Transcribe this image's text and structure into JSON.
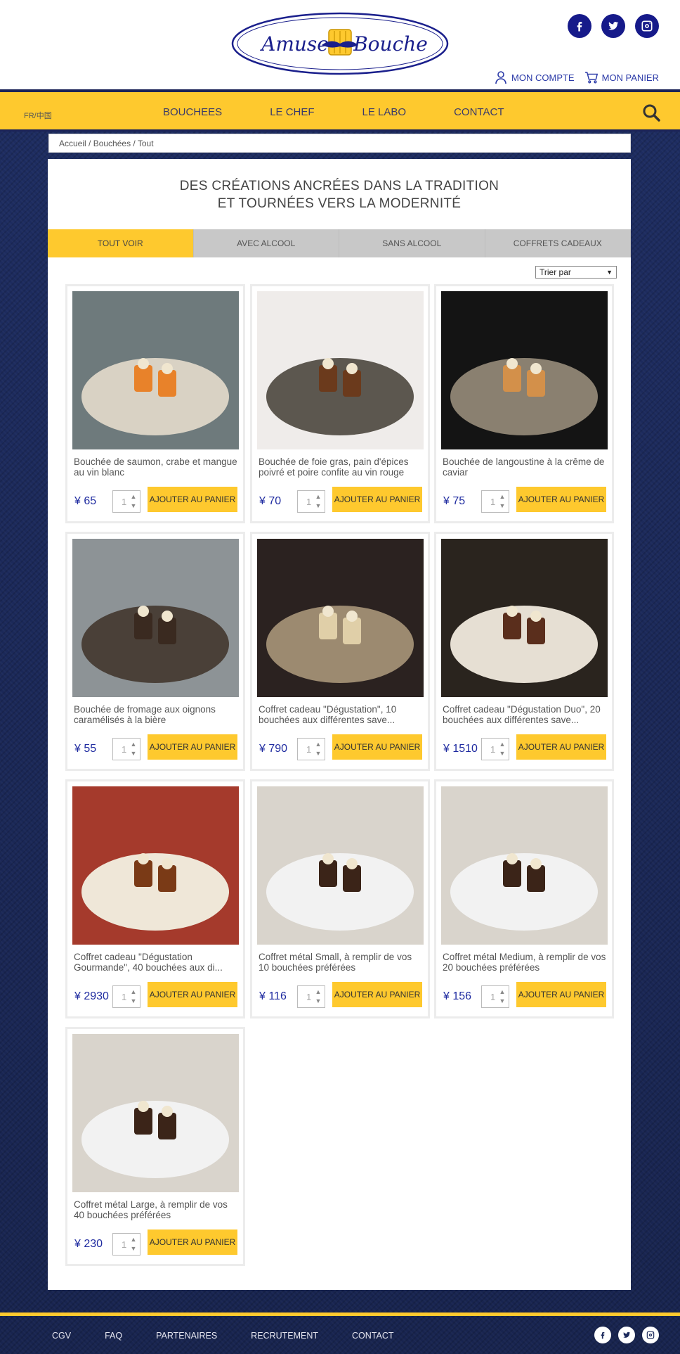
{
  "header": {
    "logo_text_left": "Amuse",
    "logo_text_right": "Bouche",
    "account_label": "MON COMPTE",
    "cart_label": "MON PANIER",
    "social": [
      "facebook-icon",
      "twitter-icon",
      "instagram-icon"
    ]
  },
  "nav": {
    "lang": "FR/中国",
    "items": [
      "BOUCHEES",
      "LE CHEF",
      "LE LABO",
      "CONTACT"
    ]
  },
  "breadcrumb": {
    "home": "Accueil",
    "sep1": " / ",
    "category": "Bouchées",
    "sep2": " / ",
    "current": "Tout"
  },
  "headline": {
    "line1": "DES CRÉATIONS ANCRÉES DANS LA TRADITION",
    "line2": "ET TOURNÉES VERS LA MODERNITÉ"
  },
  "tabs": [
    "TOUT VOIR",
    "AVEC ALCOOL",
    "SANS ALCOOL",
    "COFFRETS CADEAUX"
  ],
  "sort_label": "Trier par",
  "add_label": "AJOUTER AU PANIER",
  "qty_default": "1",
  "products": [
    {
      "name": "Bouchée de saumon, crabe et mangue au vin blanc",
      "price": "¥ 65"
    },
    {
      "name": "Bouchée de foie gras, pain d'épices poivré et poire confite au vin rouge",
      "price": "¥ 70"
    },
    {
      "name": "Bouchée de langoustine à la crême de caviar",
      "price": "¥ 75"
    },
    {
      "name": "Bouchée de fromage aux oignons caramélisés à la bière",
      "price": "¥ 55"
    },
    {
      "name": "Coffret cadeau \"Dégustation\", 10 bouchées aux différentes save...",
      "price": "¥ 790"
    },
    {
      "name": "Coffret cadeau \"Dégustation Duo\", 20 bouchées aux différentes save...",
      "price": "¥ 1510"
    },
    {
      "name": "Coffret cadeau \"Dégustation Gourmande\", 40 bouchées aux di...",
      "price": "¥ 2930"
    },
    {
      "name": "Coffret métal Small, à remplir de vos 10 bouchées préférées",
      "price": "¥ 116"
    },
    {
      "name": "Coffret métal Medium, à remplir de vos 20 bouchées préférées",
      "price": "¥ 156"
    },
    {
      "name": "Coffret métal Large, à remplir de vos 40 bouchées préférées",
      "price": "¥ 230"
    }
  ],
  "footer": {
    "links": [
      "CGV",
      "FAQ",
      "PARTENAIRES",
      "RECRUTEMENT",
      "CONTACT"
    ]
  },
  "colors": {
    "accent_yellow": "#fec92e",
    "brand_navy": "#1b2358",
    "price_blue": "#1f2ba0"
  }
}
